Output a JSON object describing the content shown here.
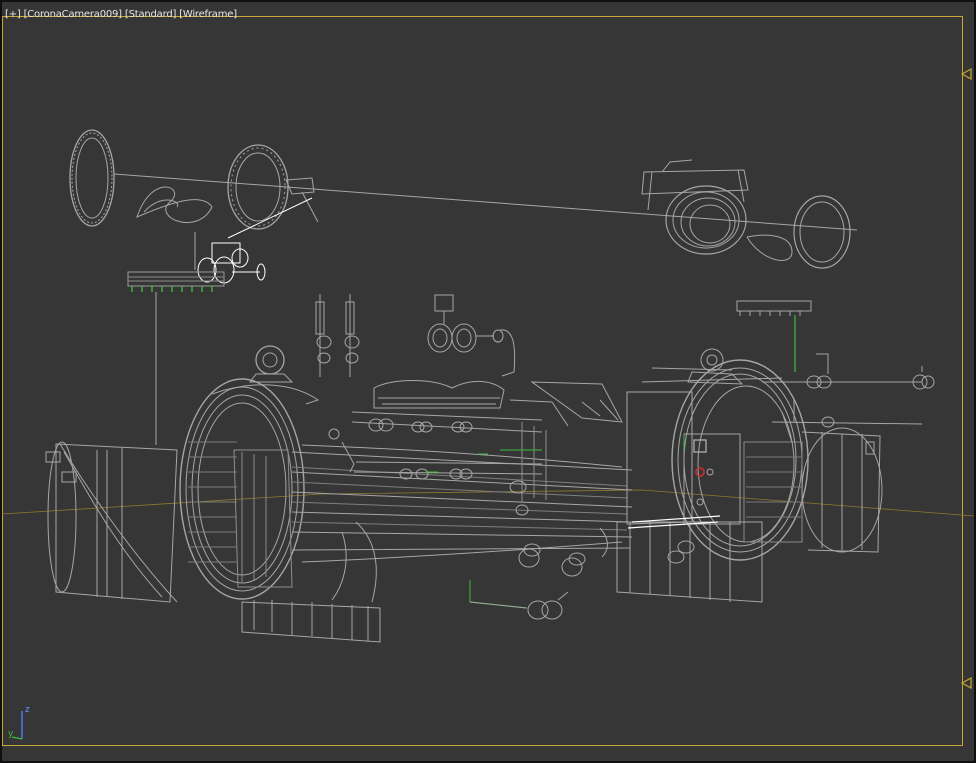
{
  "viewport": {
    "menu": {
      "plus": "[+]",
      "camera": "[CoronaCamera009]",
      "shading_mode": "[Standard]",
      "display_mode": "[Wireframe]"
    },
    "axis": {
      "z": "z",
      "y": "y"
    }
  },
  "colors": {
    "background": "#363636",
    "frame": "#c9a631",
    "wire": "#a8a8a8",
    "selected": "#ffffff",
    "green": "#3dbb3d"
  },
  "icons": [
    "viewport-plus-icon",
    "safe-frame-marker-icon",
    "axis-tripod-icon"
  ]
}
